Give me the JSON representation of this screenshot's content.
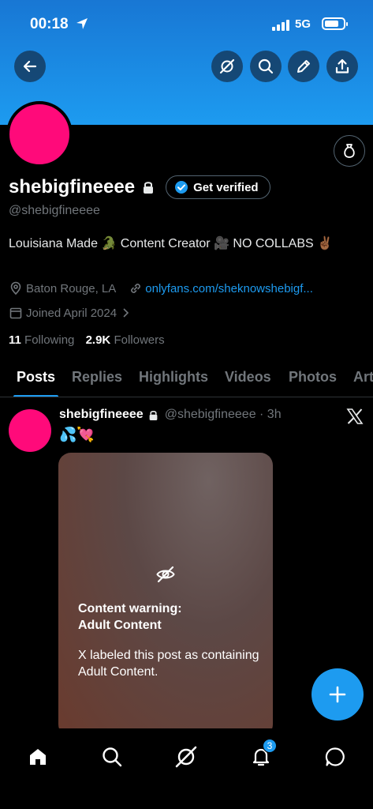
{
  "status_bar": {
    "time": "00:18",
    "network": "5G"
  },
  "profile": {
    "display_name": "shebigfineeee",
    "handle": "@shebigfineeee",
    "verify_label": "Get verified",
    "bio": "Louisiana Made 🐊 Content Creator 🎥 NO COLLABS ✌🏾",
    "location": "Baton Rouge, LA",
    "link": "onlyfans.com/sheknowshebigf...",
    "joined": "Joined April 2024",
    "following_count": "11",
    "following_label": "Following",
    "followers_count": "2.9K",
    "followers_label": "Followers"
  },
  "tabs": [
    {
      "label": "Posts"
    },
    {
      "label": "Replies"
    },
    {
      "label": "Highlights"
    },
    {
      "label": "Videos"
    },
    {
      "label": "Photos"
    },
    {
      "label": "Art"
    }
  ],
  "post": {
    "name": "shebigfineeee",
    "handle_time": "@shebigfineeee · 3h",
    "text": "💦💘",
    "warning_title_1": "Content warning:",
    "warning_title_2": "Adult Content",
    "warning_text": "X labeled this post as containing Adult Content."
  },
  "nav": {
    "notification_count": "3"
  },
  "colors": {
    "accent": "#1d9bf0",
    "avatar": "#ff0a7a",
    "background": "#000000",
    "muted": "#71767b"
  },
  "icons": [
    "back-arrow-icon",
    "grok-icon",
    "search-icon",
    "edit-icon",
    "share-icon",
    "money-bag-icon",
    "lock-icon",
    "verified-badge-icon",
    "location-icon",
    "link-icon",
    "calendar-icon",
    "x-logo-icon",
    "eye-off-icon",
    "plus-icon",
    "home-icon",
    "bell-icon",
    "message-icon"
  ]
}
